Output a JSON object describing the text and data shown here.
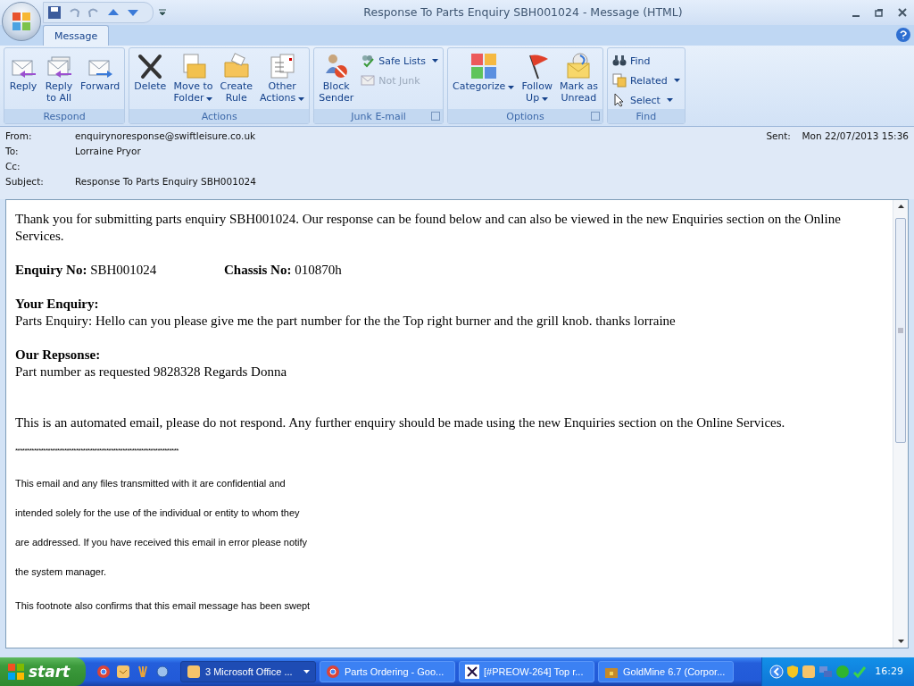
{
  "window": {
    "title": "Response To Parts Enquiry SBH001024 - Message (HTML)"
  },
  "tabs": [
    {
      "label": "Message",
      "selected": true
    }
  ],
  "ribbon": [
    {
      "label": "Respond",
      "launcher": false,
      "buttons": [
        {
          "kind": "large",
          "lines": [
            "Reply"
          ],
          "dropdown": false,
          "disabled": false
        },
        {
          "kind": "large",
          "lines": [
            "Reply",
            "to All"
          ],
          "dropdown": false,
          "disabled": false
        },
        {
          "kind": "large",
          "lines": [
            "Forward"
          ],
          "dropdown": false,
          "disabled": false
        }
      ]
    },
    {
      "label": "Actions",
      "launcher": false,
      "buttons": [
        {
          "kind": "large",
          "lines": [
            "Delete"
          ],
          "dropdown": false,
          "disabled": false
        },
        {
          "kind": "large",
          "lines": [
            "Move to",
            "Folder"
          ],
          "dropdown": true,
          "disabled": false
        },
        {
          "kind": "large",
          "lines": [
            "Create",
            "Rule"
          ],
          "dropdown": false,
          "disabled": false
        },
        {
          "kind": "large",
          "lines": [
            "Other",
            "Actions"
          ],
          "dropdown": true,
          "disabled": false
        }
      ]
    },
    {
      "label": "Junk E-mail",
      "launcher": true,
      "buttons": [
        {
          "kind": "large",
          "lines": [
            "Block",
            "Sender"
          ],
          "dropdown": false,
          "disabled": false
        },
        {
          "kind": "small",
          "lines": [
            "Safe Lists"
          ],
          "dropdown": true,
          "disabled": false
        },
        {
          "kind": "small",
          "lines": [
            "Not Junk"
          ],
          "dropdown": false,
          "disabled": true
        }
      ]
    },
    {
      "label": "Options",
      "launcher": true,
      "buttons": [
        {
          "kind": "large",
          "lines": [
            "Categorize"
          ],
          "dropdown": true,
          "disabled": false
        },
        {
          "kind": "large",
          "lines": [
            "Follow",
            "Up"
          ],
          "dropdown": true,
          "disabled": false
        },
        {
          "kind": "large",
          "lines": [
            "Mark as",
            "Unread"
          ],
          "dropdown": false,
          "disabled": false
        }
      ]
    },
    {
      "label": "Find",
      "launcher": false,
      "buttons": [
        {
          "kind": "small",
          "lines": [
            "Find"
          ],
          "dropdown": false,
          "disabled": false
        },
        {
          "kind": "small",
          "lines": [
            "Related"
          ],
          "dropdown": true,
          "disabled": false
        },
        {
          "kind": "small",
          "lines": [
            "Select"
          ],
          "dropdown": true,
          "disabled": false
        }
      ]
    }
  ],
  "header": {
    "fields": [
      {
        "label": "From:",
        "value": "enquirynoresponse@swiftleisure.co.uk"
      },
      {
        "label": "To:",
        "value": "Lorraine Pryor"
      },
      {
        "label": "Cc:"
      },
      {
        "label": "Subject:",
        "value": "Response To Parts Enquiry SBH001024"
      }
    ],
    "sent": {
      "label": "Sent:",
      "value": "Mon 22/07/2013 15:36"
    }
  },
  "body": [
    {
      "kind": "text",
      "text": "Thank you for submitting parts enquiry SBH001024. Our response can be found below and can also be viewed in the new Enquiries section on the Online Services."
    },
    {
      "kind": "fields",
      "items": [
        {
          "label": "Enquiry No:",
          "value": "SBH001024"
        },
        {
          "label": "Chassis No:",
          "value": "010870h"
        }
      ]
    },
    {
      "kind": "section",
      "heading": "Your Enquiry:",
      "text": "Parts Enquiry: Hello can you please give me the part number for the the Top right burner and the grill knob. thanks lorraine"
    },
    {
      "kind": "section",
      "heading": "Our Repsonse:",
      "text": "Part number as requested 9828328 Regards Donna"
    },
    {
      "kind": "note",
      "text": "This is an automated email, please do not respond. Any further enquiry should be made using the new Enquiries section on the Online Services."
    },
    {
      "kind": "rule",
      "text": "**********************************************************************"
    },
    {
      "kind": "small",
      "text": "This email and any files transmitted with it are confidential and"
    },
    {
      "kind": "small",
      "text": "intended solely for the use of the individual or entity to whom they"
    },
    {
      "kind": "small",
      "text": "are addressed. If you have received this email in error please notify"
    },
    {
      "kind": "small",
      "text": "the system manager."
    },
    {
      "kind": "footer",
      "text": "This footnote also confirms that this email message has been swept"
    }
  ],
  "taskbar": {
    "start": "start",
    "tasks": [
      {
        "label": "3 Microsoft Office ...",
        "selected": true,
        "dropdown": true
      },
      {
        "label": "Parts Ordering - Goo...",
        "selected": false,
        "dropdown": false
      },
      {
        "label": "[#PREOW-264] Top r...",
        "selected": false,
        "dropdown": false
      },
      {
        "label": "GoldMine 6.7 (Corpor...",
        "selected": false,
        "dropdown": false
      }
    ],
    "clock": "16:29"
  }
}
